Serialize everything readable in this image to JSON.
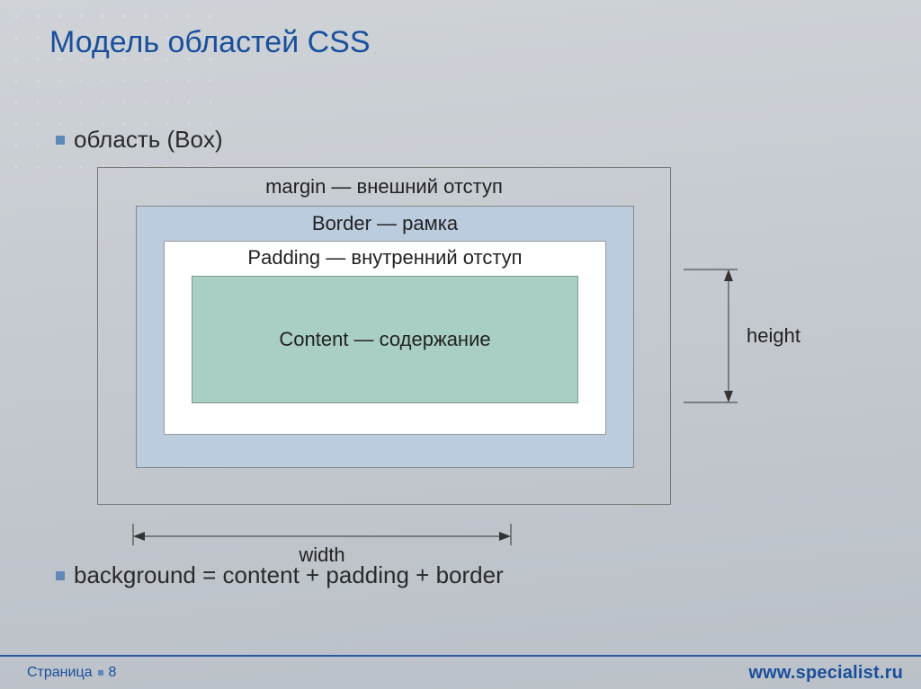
{
  "title": "Модель областей CSS",
  "bullets": {
    "box": "область (Box)",
    "background": "background = content + padding + border"
  },
  "box_model": {
    "margin_label": "margin — внешний отступ",
    "border_label": "Border — рамка",
    "padding_label": "Padding — внутренний отступ",
    "content_label": "Content — содержание"
  },
  "dimensions": {
    "width_label": "width",
    "height_label": "height"
  },
  "footer": {
    "page_word": "Страница",
    "page_number": "8",
    "site": "www.specialist.ru"
  },
  "colors": {
    "title": "#1a4f9c",
    "border_fill": "#bcccdf",
    "padding_fill": "#ffffff",
    "content_fill": "#a9cfc4"
  }
}
